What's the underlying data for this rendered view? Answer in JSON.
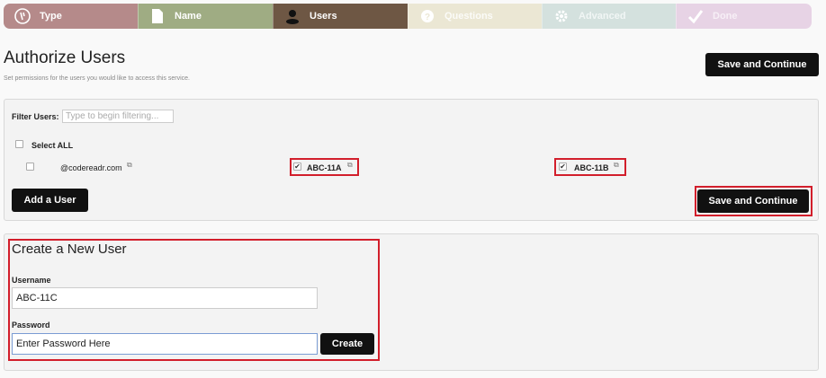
{
  "wizard": {
    "steps": [
      {
        "label": "Type",
        "icon": "type-icon"
      },
      {
        "label": "Name",
        "icon": "document-icon"
      },
      {
        "label": "Users",
        "icon": "user-icon"
      },
      {
        "label": "Questions",
        "icon": "question-icon"
      },
      {
        "label": "Advanced",
        "icon": "gear-icon"
      },
      {
        "label": "Done",
        "icon": "check-icon"
      }
    ],
    "active_step": "Users"
  },
  "header": {
    "title": "Authorize Users",
    "subtitle": "Set permissions for the users you would like to access this service.",
    "save_label": "Save and Continue"
  },
  "users_panel": {
    "filter_label": "Filter Users:",
    "filter_placeholder": "Type to begin filtering...",
    "select_all_label": "Select ALL",
    "users": [
      {
        "name": "@codereadr.com",
        "checked": false
      },
      {
        "name": "ABC-11A",
        "checked": true
      },
      {
        "name": "ABC-11B",
        "checked": true
      }
    ],
    "add_user_label": "Add a User",
    "save_label": "Save and Continue"
  },
  "create_user": {
    "title": "Create a New User",
    "username_label": "Username",
    "username_value": "ABC-11C",
    "password_label": "Password",
    "password_value": "Enter Password Here",
    "create_label": "Create"
  },
  "colors": {
    "highlight": "#d21e2b",
    "button_dark": "#111111",
    "step_active": "#6e5744"
  }
}
